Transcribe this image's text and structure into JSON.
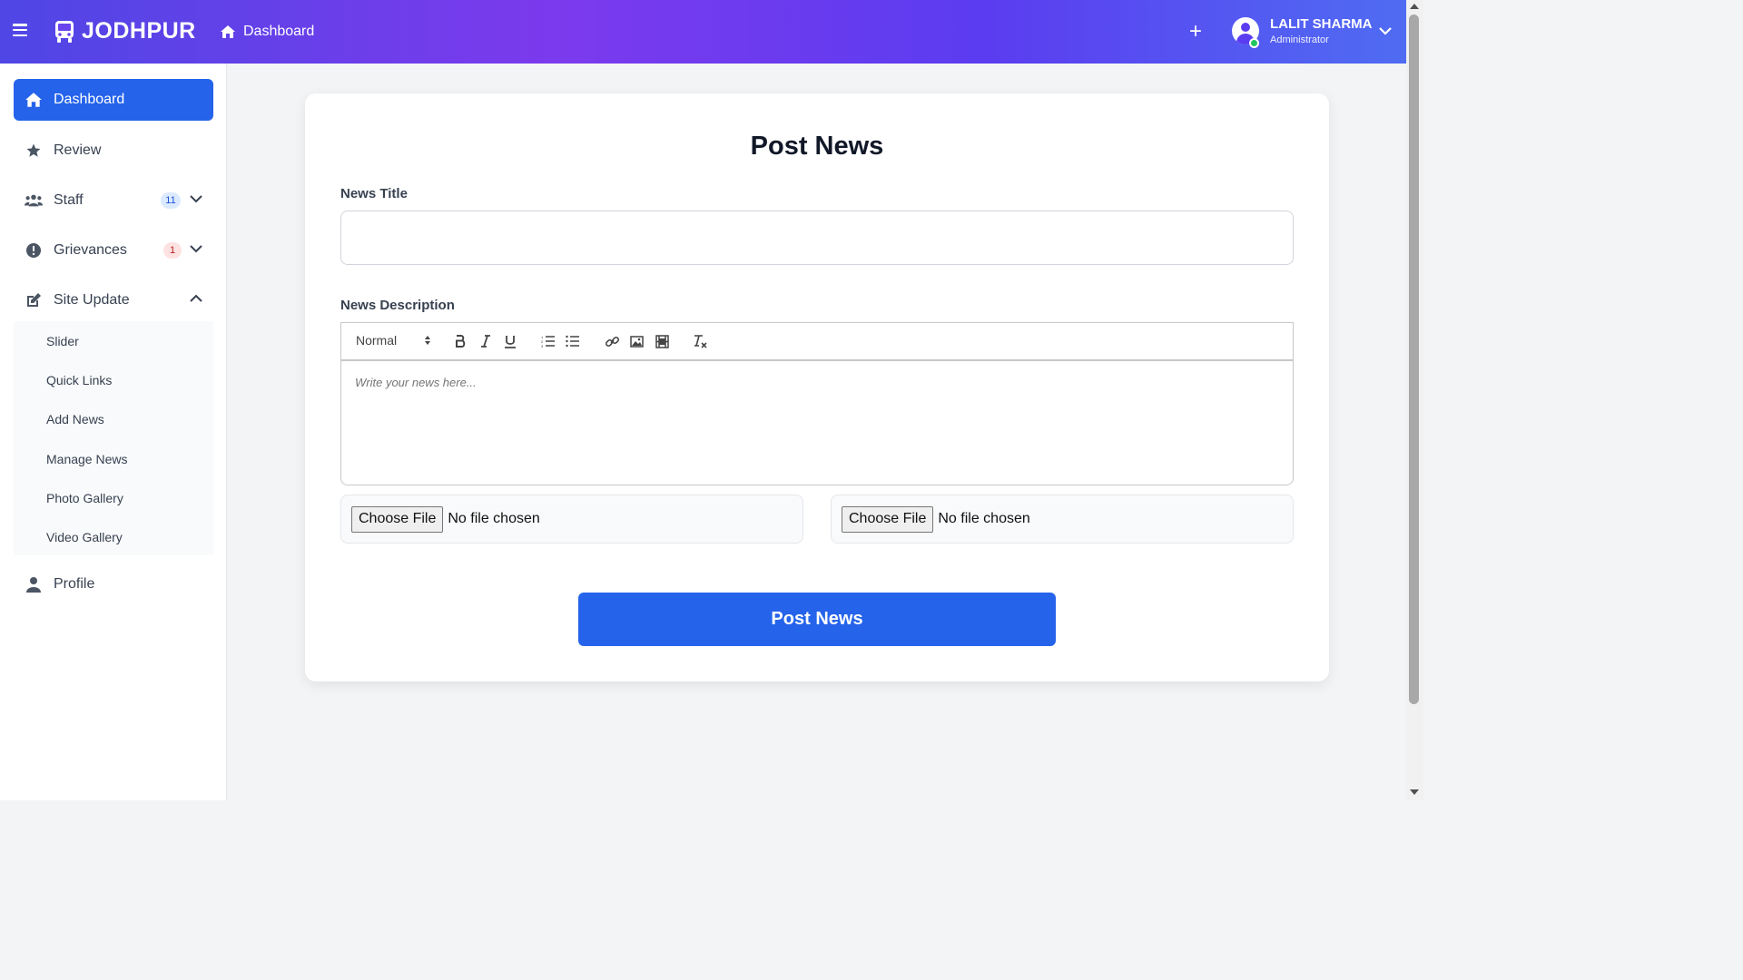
{
  "header": {
    "brand": "JODHPUR",
    "breadcrumb": "Dashboard",
    "user_name": "LALIT SHARMA",
    "user_role": "Administrator",
    "gradient_colors": [
      "#4f46e5",
      "#7c3aed",
      "#4f6cf2"
    ]
  },
  "sidebar": {
    "items": [
      {
        "label": "Dashboard",
        "icon": "home-icon",
        "active": true
      },
      {
        "label": "Review",
        "icon": "star-icon"
      },
      {
        "label": "Staff",
        "icon": "users-icon",
        "badge": "11",
        "expanded": false
      },
      {
        "label": "Grievances",
        "icon": "exclamation-circle-icon",
        "badge": "1",
        "expanded": false
      },
      {
        "label": "Site Update",
        "icon": "edit-icon",
        "expanded": true
      },
      {
        "label": "Profile",
        "icon": "user-icon"
      }
    ],
    "site_update_submenu": [
      "Slider",
      "Quick Links",
      "Add News",
      "Manage News",
      "Photo Gallery",
      "Video Gallery"
    ],
    "active_color": "#2563eb"
  },
  "form": {
    "title": "Post News",
    "news_title_label": "News Title",
    "news_title_value": "",
    "news_description_label": "News Description",
    "editor_placeholder": "Write your news here...",
    "format_select": "Normal",
    "toolbar_buttons": [
      "bold",
      "italic",
      "underline",
      "ordered-list",
      "bullet-list",
      "link",
      "image",
      "video",
      "clear-format"
    ],
    "file_inputs": [
      {
        "button": "Choose File",
        "status": "No file chosen"
      },
      {
        "button": "Choose File",
        "status": "No file chosen"
      }
    ],
    "submit_label": "Post News",
    "submit_color": "#2563eb"
  }
}
